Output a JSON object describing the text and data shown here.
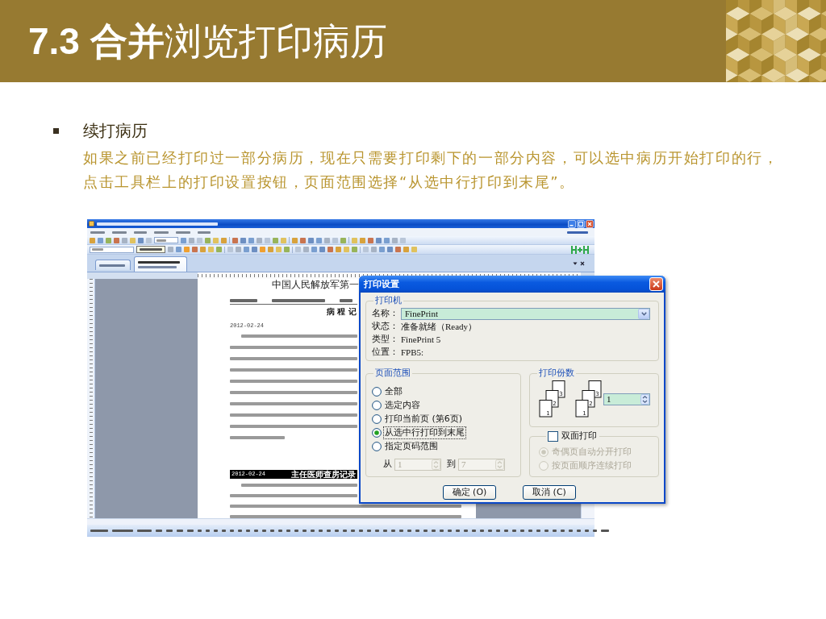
{
  "header": {
    "title": "**7.3 合并**浏览打印病历"
  },
  "bullet": {
    "heading": "续打病历",
    "text": "如果之前已经打印过一部分病历，现在只需要打印剩下的一部分内容，可以选中病历开始打印的行，点击工具栏上的打印设置按钮，页面范围选择“从选中行打印到末尾”。"
  },
  "app_window": {
    "document": {
      "title": "中国人民解放军第一",
      "section": "病 程 记",
      "entries": [
        {
          "kind": "plain",
          "date": "2012-02-24"
        },
        {
          "kind": "banner",
          "date": "2012-02-24",
          "heading": "主任医师查房记录"
        }
      ]
    }
  },
  "print_dialog": {
    "title": "打印设置",
    "printer": {
      "legend": "打印机",
      "name_label": "名称：",
      "name": "FinePrint",
      "fields": [
        {
          "label": "状态：",
          "value": "准备就绪（Ready）"
        },
        {
          "label": "类型：",
          "value": "FinePrint 5"
        },
        {
          "label": "位置：",
          "value": "FPB5:"
        }
      ]
    },
    "page_range": {
      "legend": "页面范围",
      "options": [
        {
          "label": "全部",
          "selected": false
        },
        {
          "label": "选定内容",
          "selected": false
        },
        {
          "label": "打印当前页 (第6页)",
          "selected": false
        },
        {
          "label": "从选中行打印到末尾",
          "selected": true
        },
        {
          "label": "指定页码范围",
          "selected": false
        }
      ],
      "from": {
        "label": "从",
        "value": "1",
        "disabled": true
      },
      "to": {
        "label": "到",
        "value": "7",
        "disabled": true
      }
    },
    "copies": {
      "legend": "打印份数",
      "stacks": [
        {
          "pages": [
            "3",
            "2",
            "1"
          ]
        },
        {
          "pages": [
            "3",
            "2",
            "1"
          ]
        }
      ],
      "value": "1"
    },
    "duplex": {
      "label": "双面打印",
      "checked": false,
      "options": [
        {
          "label": "奇偶页自动分开打印",
          "selected": true
        },
        {
          "label": "按页面顺序连续打印",
          "selected": false
        }
      ]
    },
    "buttons": [
      "确定 (O)",
      "取消 (C)"
    ]
  }
}
